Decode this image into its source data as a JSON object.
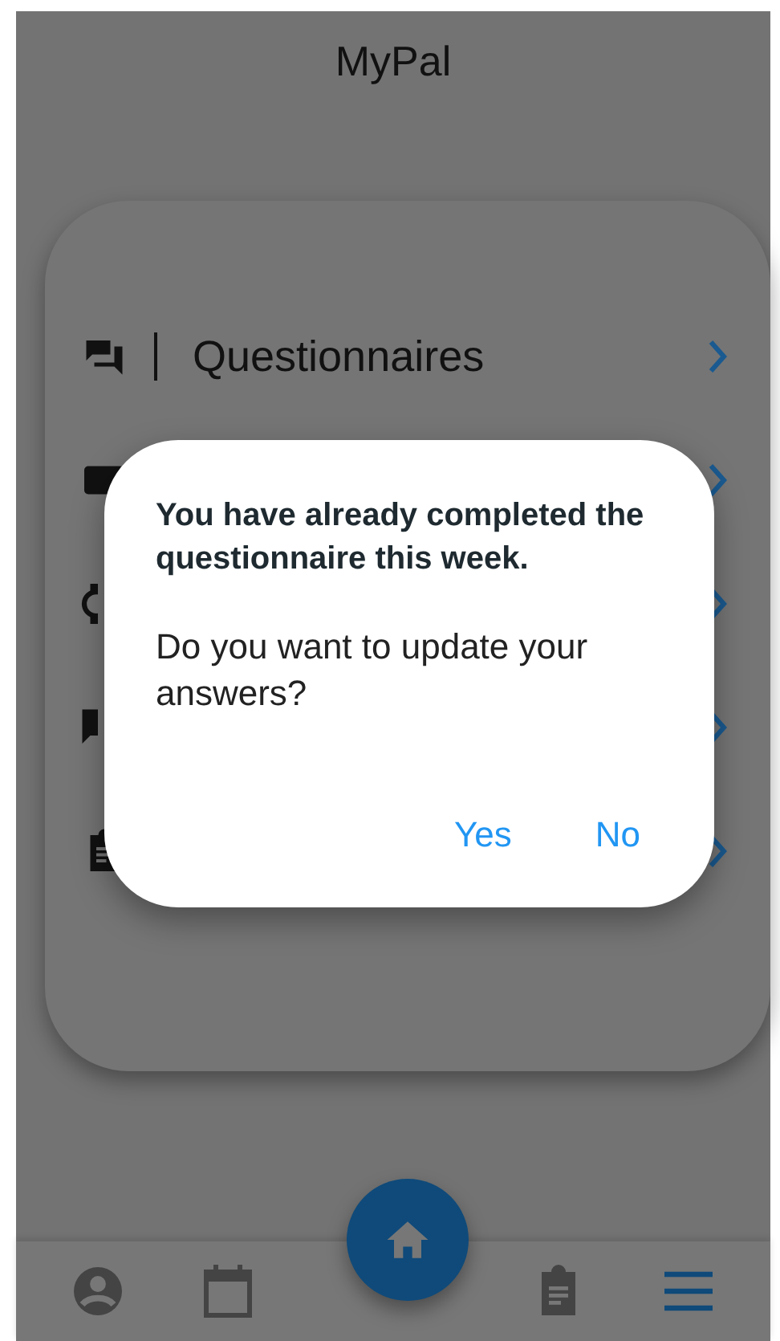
{
  "app_bar": {
    "title": "MyPal"
  },
  "menu": {
    "items": [
      {
        "kind": "chat",
        "label": "Questionnaires"
      },
      {
        "kind": "card"
      },
      {
        "kind": "watch"
      },
      {
        "kind": "bubble"
      },
      {
        "kind": "clipboard"
      }
    ]
  },
  "dialog": {
    "title": "You have already completed the questionnaire this week.",
    "message": "Do you want to update your answers?",
    "buttons": [
      "Yes",
      "No"
    ]
  },
  "bottom_nav": {
    "items": [
      {
        "kind": "profile",
        "selected": false
      },
      {
        "kind": "calendar",
        "selected": false
      },
      {
        "kind": "clipboard",
        "selected": false
      },
      {
        "kind": "menu",
        "selected": true
      }
    ]
  }
}
